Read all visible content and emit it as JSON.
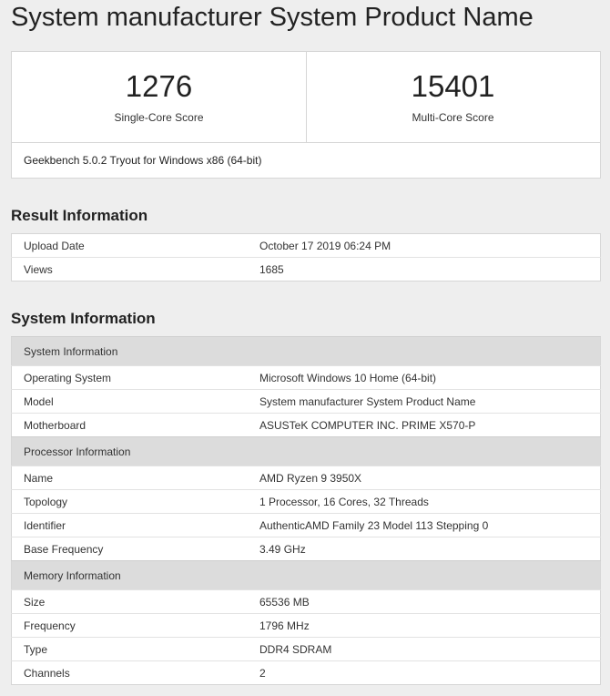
{
  "page": {
    "title": "System manufacturer System Product Name"
  },
  "scores": {
    "single": {
      "value": "1276",
      "label": "Single-Core Score"
    },
    "multi": {
      "value": "15401",
      "label": "Multi-Core Score"
    },
    "version": "Geekbench 5.0.2 Tryout for Windows x86 (64-bit)"
  },
  "result_info": {
    "heading": "Result Information",
    "rows": [
      {
        "key": "Upload Date",
        "value": "October 17 2019 06:24 PM"
      },
      {
        "key": "Views",
        "value": "1685"
      }
    ]
  },
  "system_info": {
    "heading": "System Information",
    "groups": [
      {
        "title": "System Information",
        "rows": [
          {
            "key": "Operating System",
            "value": "Microsoft Windows 10 Home (64-bit)"
          },
          {
            "key": "Model",
            "value": "System manufacturer System Product Name"
          },
          {
            "key": "Motherboard",
            "value": "ASUSTeK COMPUTER INC. PRIME X570-P"
          }
        ]
      },
      {
        "title": "Processor Information",
        "rows": [
          {
            "key": "Name",
            "value": "AMD Ryzen 9 3950X"
          },
          {
            "key": "Topology",
            "value": "1 Processor, 16 Cores, 32 Threads"
          },
          {
            "key": "Identifier",
            "value": "AuthenticAMD Family 23 Model 113 Stepping 0"
          },
          {
            "key": "Base Frequency",
            "value": "3.49 GHz"
          }
        ]
      },
      {
        "title": "Memory Information",
        "rows": [
          {
            "key": "Size",
            "value": "65536 MB"
          },
          {
            "key": "Frequency",
            "value": "1796 MHz"
          },
          {
            "key": "Type",
            "value": "DDR4 SDRAM"
          },
          {
            "key": "Channels",
            "value": "2"
          }
        ]
      }
    ]
  }
}
